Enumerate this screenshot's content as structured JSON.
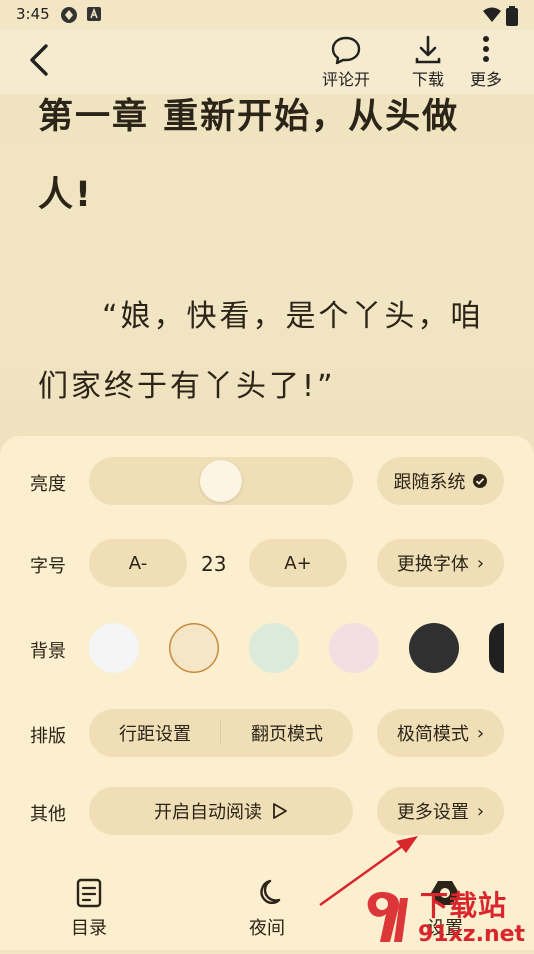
{
  "status_bar": {
    "time": "3:45"
  },
  "toolbar": {
    "comment_label": "评论开",
    "download_label": "下载",
    "more_label": "更多"
  },
  "reader": {
    "chapter_title": "第一章 重新开始，从头做人!",
    "paragraph": "“娘，快看，是个丫头，咱们家终于有丫头了!”"
  },
  "settings": {
    "brightness": {
      "label": "亮度",
      "level": 0.5,
      "follow_system_label": "跟随系统"
    },
    "font_size": {
      "label": "字号",
      "decrease_label": "A-",
      "value": "23",
      "increase_label": "A+",
      "change_font_label": "更换字体"
    },
    "background": {
      "label": "背景",
      "swatches": [
        "#f5f5f5",
        "#f5e6c8",
        "#dceadb",
        "#f1dfe2",
        "#303030",
        "#202020"
      ],
      "selected_index": 1
    },
    "layout": {
      "label": "排版",
      "line_spacing_label": "行距设置",
      "page_mode_label": "翻页模式",
      "minimal_mode_label": "极简模式"
    },
    "other": {
      "label": "其他",
      "auto_read_label": "开启自动阅读",
      "more_settings_label": "更多设置"
    }
  },
  "bottom_nav": {
    "toc_label": "目录",
    "night_label": "夜间",
    "settings_label": "设置"
  },
  "watermark": {
    "text_top": "下载站",
    "text_bottom": "91xz.net"
  },
  "colors": {
    "panel_bg": "#fbefcf",
    "pill_bg": "#f0dfb6",
    "page_bg": "#f3e6c4",
    "arrow": "#d9262c"
  }
}
